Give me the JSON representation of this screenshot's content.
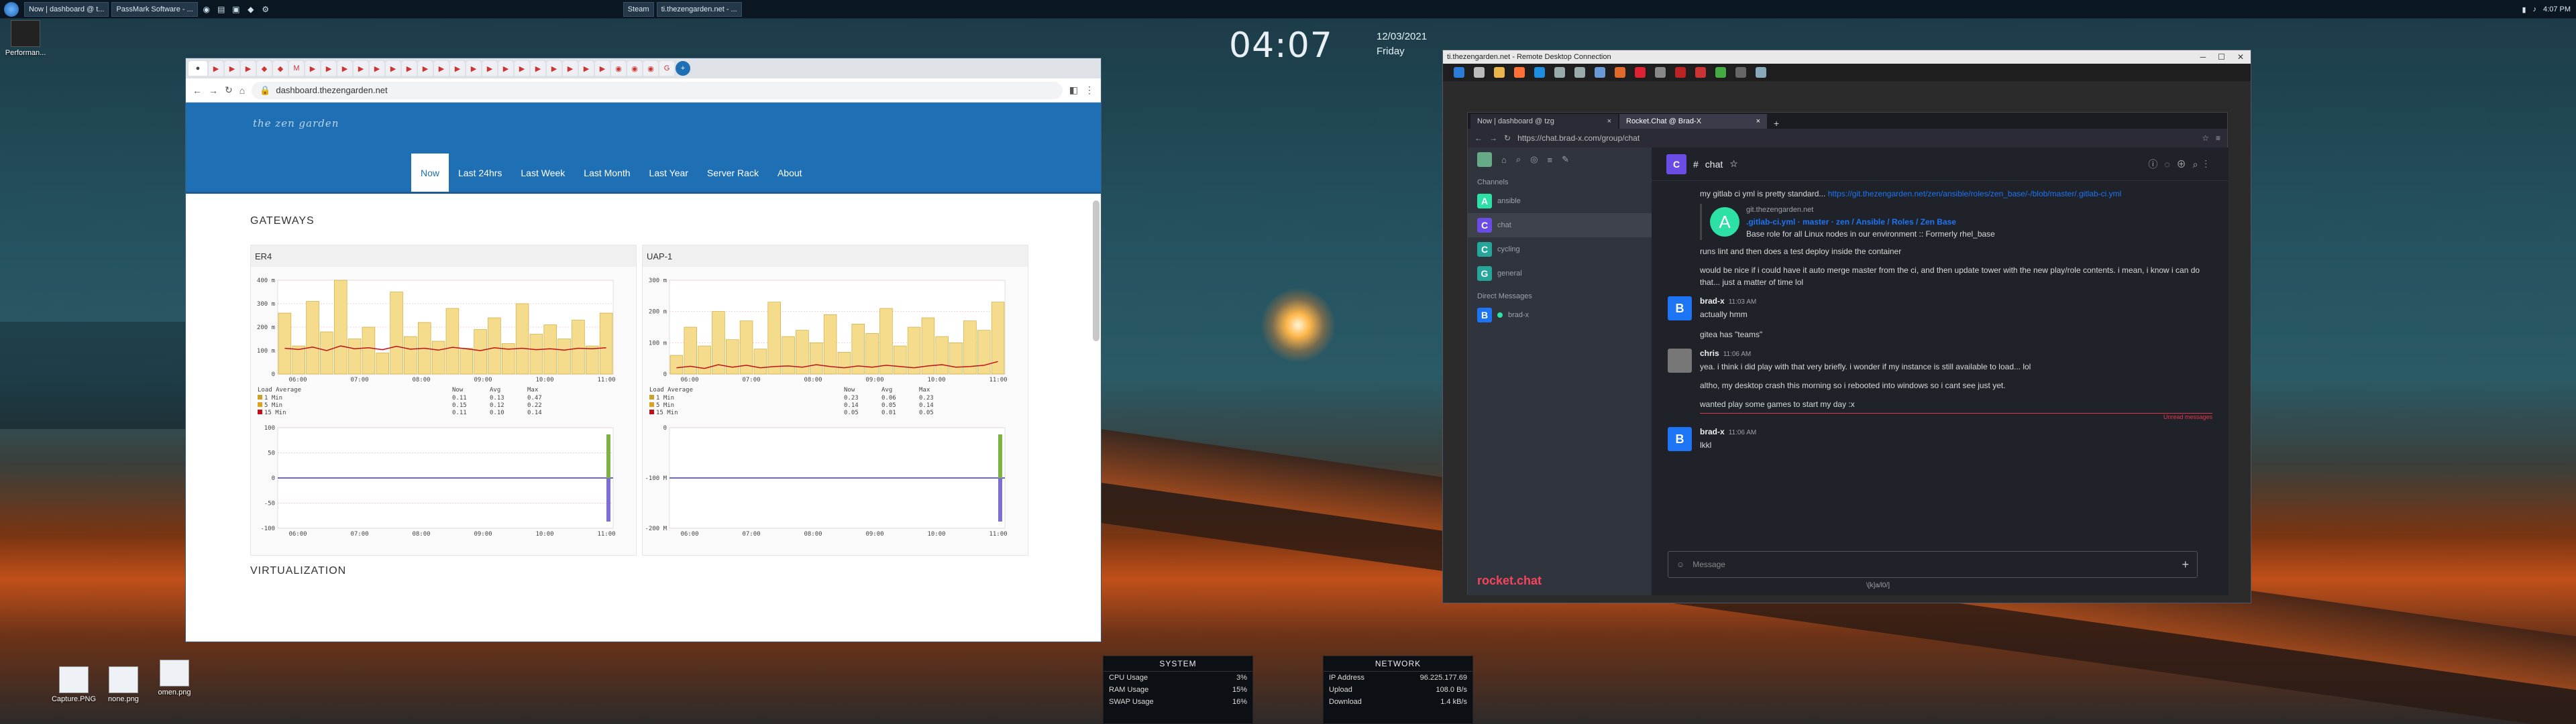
{
  "taskbar": {
    "tasks": [
      "Now | dashboard @ t...",
      "PassMark Software - ...",
      "Steam",
      "ti.thezengarden.net - ..."
    ],
    "time": "4:07 PM"
  },
  "desktop": {
    "clock": "04:07",
    "date": "12/03/2021",
    "day": "Friday",
    "icons": [
      "Performan...",
      "Capture.PNG",
      "none.png",
      "omen.png"
    ]
  },
  "win1": {
    "url": "dashboard.thezengarden.net",
    "brand": "the zen garden",
    "nav": [
      "Now",
      "Last 24hrs",
      "Last Week",
      "Last Month",
      "Last Year",
      "Server Rack",
      "About"
    ],
    "section1": "GATEWAYS",
    "section2": "VIRTUALIZATION",
    "gateways": [
      {
        "name": "ER4",
        "legend_title": "Load Average",
        "cols": [
          "Now",
          "Avg",
          "Max"
        ],
        "rows": [
          {
            "label": "1 Min",
            "vals": [
              "0.11",
              "0.13",
              "0.47"
            ]
          },
          {
            "label": "5 Min",
            "vals": [
              "0.15",
              "0.12",
              "0.22"
            ]
          },
          {
            "label": "15 Min",
            "vals": [
              "0.11",
              "0.10",
              "0.14"
            ]
          }
        ],
        "yticks": [
          "400 m",
          "300 m",
          "200 m",
          "100 m",
          "0"
        ],
        "xticks": [
          "06:00",
          "07:00",
          "08:00",
          "09:00",
          "10:00",
          "11:00"
        ],
        "yticks2": [
          "100",
          "50",
          "0",
          "-50",
          "-100"
        ]
      },
      {
        "name": "UAP-1",
        "legend_title": "Load Average",
        "cols": [
          "Now",
          "Avg",
          "Max"
        ],
        "rows": [
          {
            "label": "1 Min",
            "vals": [
              "0.23",
              "0.06",
              "0.23"
            ]
          },
          {
            "label": "5 Min",
            "vals": [
              "0.14",
              "0.05",
              "0.14"
            ]
          },
          {
            "label": "15 Min",
            "vals": [
              "0.05",
              "0.01",
              "0.05"
            ]
          }
        ],
        "yticks": [
          "300 m",
          "200 m",
          "100 m",
          "0"
        ],
        "xticks": [
          "06:00",
          "07:00",
          "08:00",
          "09:00",
          "10:00",
          "11:00"
        ],
        "yticks2": [
          "0",
          "-100 M",
          "-200 M"
        ]
      }
    ]
  },
  "win2": {
    "title": "ti.thezengarden.net - Remote Desktop Connection",
    "tabs": [
      "Now | dashboard @ tzg",
      "Rocket.Chat @ Brad-X"
    ],
    "url": "https://chat.brad-x.com/group/chat",
    "sections": {
      "channels": "Channels",
      "dm": "Direct Messages"
    },
    "channels": [
      {
        "letter": "A",
        "name": "ansible",
        "color": "#2de0a5"
      },
      {
        "letter": "C",
        "name": "chat",
        "color": "#6b4de6"
      },
      {
        "letter": "C",
        "name": "cycling",
        "color": "#26a69a"
      },
      {
        "letter": "G",
        "name": "general",
        "color": "#26a69a"
      }
    ],
    "dm": [
      {
        "letter": "B",
        "name": "brad-x",
        "color": "#1d74f5"
      }
    ],
    "room": "chat",
    "messages": [
      {
        "text": "my gitlab ci yml is pretty standard...",
        "link": "https://git.thezengarden.net/zen/ansible/roles/zen_base/-/blob/master/.gitlab-ci.yml"
      },
      {
        "card_site": "git.thezengarden.net",
        "card_title": ".gitlab-ci.yml · master · zen / Ansible / Roles / Zen Base",
        "card_desc": "Base role for all Linux nodes in our environment :: Formerly rhel_base"
      },
      {
        "text": "runs lint and then does a test deploy inside the container"
      },
      {
        "text": "would be nice if i could have it auto merge master from the ci, and then update tower with the new play/role contents. i mean, i know i can do that... just a matter of time lol"
      },
      {
        "user": "brad-x",
        "time": "11:03 AM",
        "text": "actually hmm"
      },
      {
        "text": "gitea has \"teams\""
      },
      {
        "user": "chris",
        "time": "11:06 AM",
        "text": "yea. i think i did play with that very briefly. i wonder if my instance is still available to load... lol"
      },
      {
        "text": "altho, my desktop crash this morning so i rebooted into windows so i cant see just yet."
      },
      {
        "text": "wanted play some games to start my day :x"
      },
      {
        "unread": "Unread messages"
      },
      {
        "user": "brad-x",
        "time": "11:06 AM",
        "text": "lkkl"
      }
    ],
    "compose_placeholder": "Message",
    "logo": "rocket.chat",
    "footer": "\\[k]a/l0/]"
  },
  "widgets": {
    "system": {
      "title": "SYSTEM",
      "rows": [
        [
          "CPU Usage",
          "3%"
        ],
        [
          "RAM Usage",
          "15%"
        ],
        [
          "SWAP Usage",
          "16%"
        ]
      ]
    },
    "network": {
      "title": "NETWORK",
      "rows": [
        [
          "IP Address",
          "96.225.177.69"
        ],
        [
          "Upload",
          "108.0 B/s"
        ],
        [
          "Download",
          "1.4 kB/s"
        ]
      ]
    }
  },
  "chart_data": [
    {
      "type": "bar",
      "title": "ER4",
      "ylabel": "Load Average",
      "x": [
        "06:00",
        "07:00",
        "08:00",
        "09:00",
        "10:00",
        "11:00"
      ],
      "ylim": [
        0,
        400
      ],
      "series": [
        {
          "name": "1 Min",
          "values": [
            260,
            120,
            310,
            180,
            400,
            150,
            200,
            90,
            350,
            160,
            220,
            140,
            280,
            110,
            190,
            240,
            130,
            300,
            170,
            210,
            150,
            230,
            120,
            260
          ]
        },
        {
          "name": "15 Min",
          "values": [
            110,
            105,
            115,
            100,
            120,
            108,
            112,
            104,
            118,
            106,
            110,
            102,
            114,
            108,
            100,
            112,
            106,
            110,
            104,
            108,
            102,
            110,
            108,
            112
          ]
        }
      ]
    },
    {
      "type": "bar",
      "title": "UAP-1",
      "ylabel": "Load Average",
      "x": [
        "06:00",
        "07:00",
        "08:00",
        "09:00",
        "10:00",
        "11:00"
      ],
      "ylim": [
        0,
        300
      ],
      "series": [
        {
          "name": "1 Min",
          "values": [
            60,
            150,
            90,
            200,
            110,
            170,
            80,
            230,
            120,
            140,
            100,
            190,
            70,
            160,
            130,
            210,
            90,
            150,
            180,
            120,
            100,
            170,
            140,
            230
          ]
        },
        {
          "name": "15 Min",
          "values": [
            20,
            25,
            18,
            30,
            22,
            28,
            20,
            24,
            26,
            22,
            30,
            24,
            20,
            26,
            22,
            28,
            24,
            20,
            26,
            30,
            22,
            24,
            28,
            40
          ]
        }
      ]
    }
  ]
}
